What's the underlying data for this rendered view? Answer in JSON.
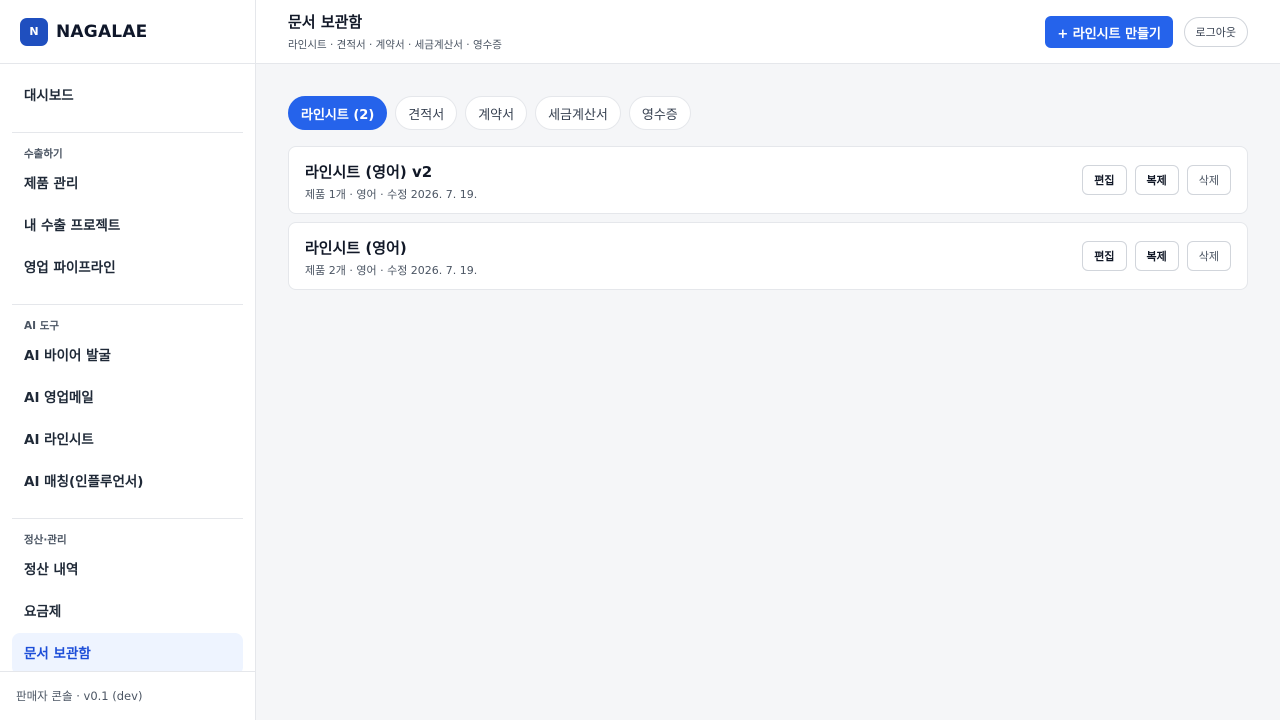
{
  "brand": {
    "logo": "N",
    "name": "NAGALAE"
  },
  "sidebar": {
    "top_item": "대시보드",
    "sections": [
      {
        "title": "수출하기",
        "items": [
          "제품 관리",
          "내 수출 프로젝트",
          "영업 파이프라인"
        ]
      },
      {
        "title": "AI 도구",
        "items": [
          "AI 바이어 발굴",
          "AI 영업메일",
          "AI 라인시트",
          "AI 매칭(인플루언서)"
        ]
      },
      {
        "title": "정산·관리",
        "items": [
          "정산 내역",
          "요금제",
          "문서 보관함"
        ]
      }
    ],
    "active_item": "문서 보관함",
    "footer": "판매자 콘솔 · v0.1 (dev)"
  },
  "header": {
    "title": "문서 보관함",
    "subtitle": "라인시트 · 견적서 · 계약서 · 세금계산서 · 영수증",
    "create_label": "+ 라인시트 만들기",
    "logout_label": "로그아웃"
  },
  "tabs": [
    "라인시트 (2)",
    "견적서",
    "계약서",
    "세금계산서",
    "영수증"
  ],
  "active_tab": 0,
  "documents": [
    {
      "title": "라인시트 (영어) v2",
      "meta": "제품 1개 · 영어 · 수정 2026. 7. 19."
    },
    {
      "title": "라인시트 (영어)",
      "meta": "제품 2개 · 영어 · 수정 2026. 7. 19."
    }
  ],
  "actions": {
    "edit": "편집",
    "copy": "복제",
    "delete": "삭제"
  },
  "colors": {
    "accent": "#2563eb",
    "brand": "#1f4fbf",
    "active_nav_bg": "#eef4ff"
  }
}
